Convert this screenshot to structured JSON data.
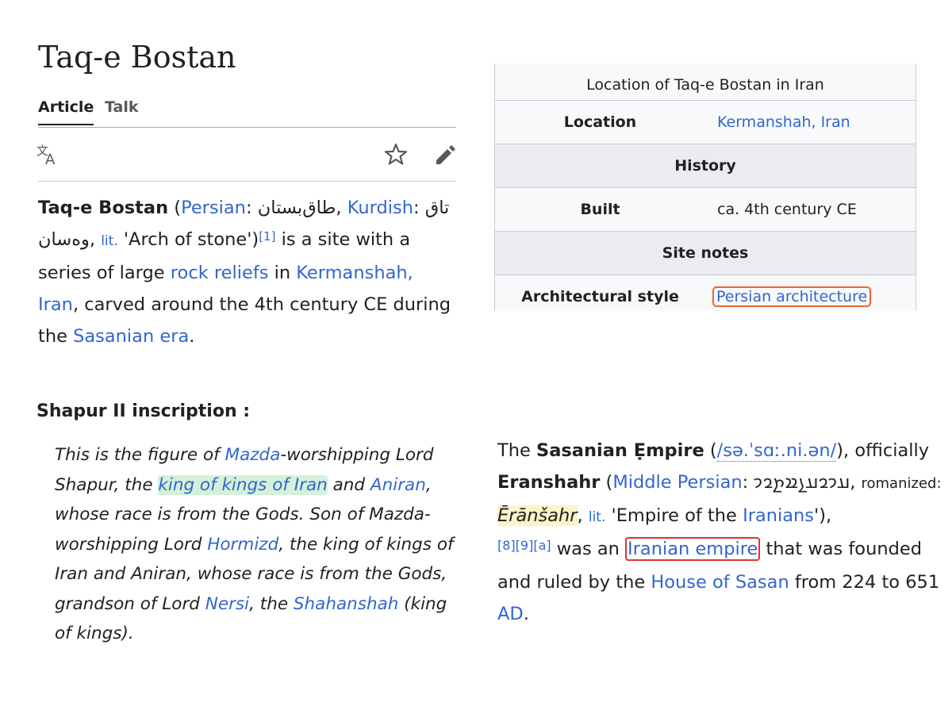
{
  "title": "Taq-e Bostan",
  "tabs": {
    "article": "Article",
    "talk": "Talk"
  },
  "icons": {
    "translate": "translate-icon",
    "watch": "star-icon",
    "edit": "pencil-icon"
  },
  "intro": {
    "name": "Taq-e Bostan",
    "open": " (",
    "persian_link": "Persian",
    "persian_text": ": طاق‌بستان, ",
    "kurdish_link": "Kurdish",
    "kurdish_text": ": تاق وەسان, ",
    "lit": "lit.",
    "lit_text": " 'Arch of stone')",
    "ref1": "[1]",
    "t1": " is a site with a series of large ",
    "rock_reliefs": "rock reliefs",
    "t2": " in ",
    "kermanshah": "Kermanshah, Iran",
    "t3": ", carved around the 4th century CE during the ",
    "sasanian_era": "Sasanian era",
    "t4": "."
  },
  "infobox": {
    "caption": "Location of Taq-e Bostan in Iran",
    "location_label": "Location",
    "location_value": "Kermanshah, Iran",
    "history_header": "History",
    "built_label": "Built",
    "built_value": "ca. 4th century CE",
    "site_notes_header": "Site notes",
    "arch_label": "Architectural style",
    "arch_value": "Persian architecture"
  },
  "inscription": {
    "heading": "Shapur II inscription :",
    "q1": "This is the figure of ",
    "mazda": "Mazda",
    "q2": "-worshipping Lord Shapur, the ",
    "king_of_kings": "king of kings of Iran",
    "q3": " and ",
    "aniran": "Aniran",
    "q4": ", whose race is from the Gods. Son of Mazda-worshipping Lord ",
    "hormizd": "Hormizd",
    "q5": ", the king of kings of Iran and Aniran, whose race is from the Gods, grandson of Lord ",
    "nersi": "Nersi",
    "q6": ", the ",
    "shahanshah": "Shahanshah",
    "q7": " (king of kings)."
  },
  "sasanian": {
    "the": "The ",
    "empire": "Sasanian Ẹmpire",
    "open": " (",
    "ipa": "/sə.ˈsɑː.ni.ən/",
    "t1": "), officially ",
    "eranshahr": "Eranshahr",
    "open2": " (",
    "middle_persian": "Middle Persian",
    "mp_text": ": 𐭠𐭩𐭥𐭠𐭭𐭱𐭲𐭥𐭩, ",
    "romanized": "romanized: ",
    "eransahr": "Ērānšahr",
    "comma": ", ",
    "lit": "lit.",
    "lit_text": " 'Empire of the ",
    "iranians": "Iranians",
    "t2": "'),",
    "refs": "[8][9][a]",
    "t3": " was an ",
    "iranian_empire": "Iranian empire",
    "t4": " that was founded and ruled by the ",
    "house": "House of Sasan",
    "t5": " from 224 to 651 ",
    "ad": "AD",
    "t6": "."
  }
}
